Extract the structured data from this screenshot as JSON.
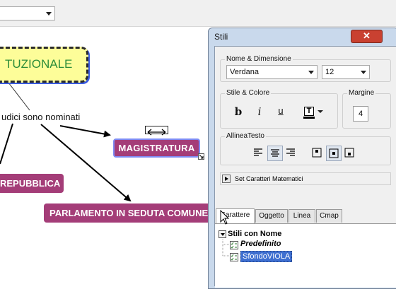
{
  "toolbar": {
    "font_combo_value": ""
  },
  "map": {
    "title_node": "TUZIONALE",
    "link_label": "udici sono nominati",
    "nodes": {
      "magistratura": "MAGISTRATURA",
      "repubblica": "REPUBBLICA",
      "parlamento": "PARLAMENTO IN SEDUTA COMUNE"
    }
  },
  "styles_panel": {
    "title": "Stili",
    "close_label": "✕",
    "font_group": {
      "label": "Nome & Dimensione",
      "font": "Verdana",
      "size": "12"
    },
    "style_group": {
      "label": "Stile & Colore",
      "bold": "b",
      "italic": "i",
      "underline": "u",
      "color_glyph": "T"
    },
    "margin_group": {
      "label": "Margine",
      "value": "4"
    },
    "align_group": {
      "label": "AllineaTesto"
    },
    "math_button": "Set Caratteri Matematici",
    "tabs": [
      "Carattere",
      "Oggetto",
      "Linea",
      "Cmap"
    ],
    "named_styles": {
      "header": "Stili con Nome",
      "items": [
        "Predefinito",
        "SfondoVIOLA"
      ]
    }
  }
}
